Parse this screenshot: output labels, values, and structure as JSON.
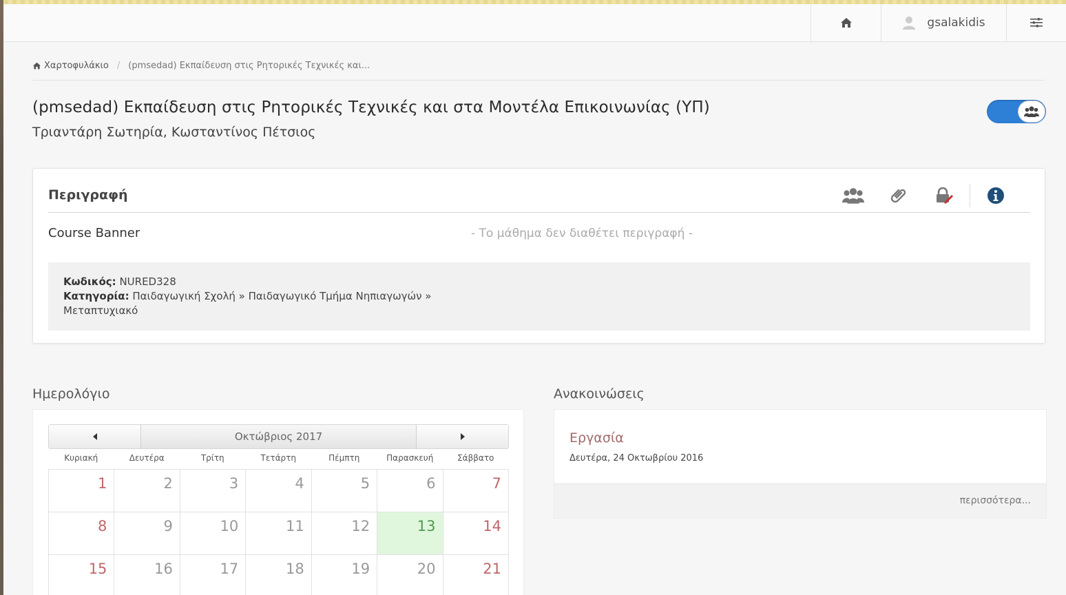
{
  "navbar": {
    "home_icon": "home-icon",
    "user_icon": "user-icon",
    "username": "gsalakidis",
    "settings_icon": "sliders-icon"
  },
  "breadcrumb": {
    "home_label": "Χαρτοφυλάκιο",
    "separator": "/",
    "current": "(pmsedad) Εκπαίδευση στις Ρητορικές Τεχνικές και..."
  },
  "course": {
    "title": "(pmsedad) Εκπαίδευση στις Ρητορικές Τεχνικές και στα Μοντέλα Επικοινωνίας (ΥΠ)",
    "professors": "Τριαντάρη Σωτηρία, Κωσταντίνος Πέτσιος",
    "toggle_on": true,
    "toggle_color": "#2e7fd6"
  },
  "description_panel": {
    "title": "Περιγραφή",
    "icons": [
      "users-icon",
      "paperclip-icon",
      "lock-icon",
      "info-icon"
    ],
    "banner_label": "Course Banner",
    "no_description": "- Το μάθημα δεν διαθέτει περιγραφή -",
    "code_label": "Κωδικός:",
    "code_value": "NURED328",
    "category_label": "Κατηγορία:",
    "category_value_line1": "Παιδαγωγική Σχολή » Παιδαγωγικό Τμήμα Νηπιαγωγών »",
    "category_value_line2": "Μεταπτυχιακό"
  },
  "calendar": {
    "section_title": "Ημερολόγιο",
    "month_label": "Οκτώβριος 2017",
    "weekdays": [
      "Κυριακή",
      "Δευτέρα",
      "Τρίτη",
      "Τετάρτη",
      "Πέμπτη",
      "Παρασκευή",
      "Σάββατο"
    ],
    "weeks": [
      [
        "1",
        "2",
        "3",
        "4",
        "5",
        "6",
        "7"
      ],
      [
        "8",
        "9",
        "10",
        "11",
        "12",
        "13",
        "14"
      ],
      [
        "15",
        "16",
        "17",
        "18",
        "19",
        "20",
        "21"
      ]
    ],
    "today": "13"
  },
  "announcements": {
    "section_title": "Ανακοινώσεις",
    "item_title": "Εργασία",
    "item_date": "Δευτέρα, 24 Οκτωβρίου 2016",
    "more_label": "περισσότερα..."
  }
}
